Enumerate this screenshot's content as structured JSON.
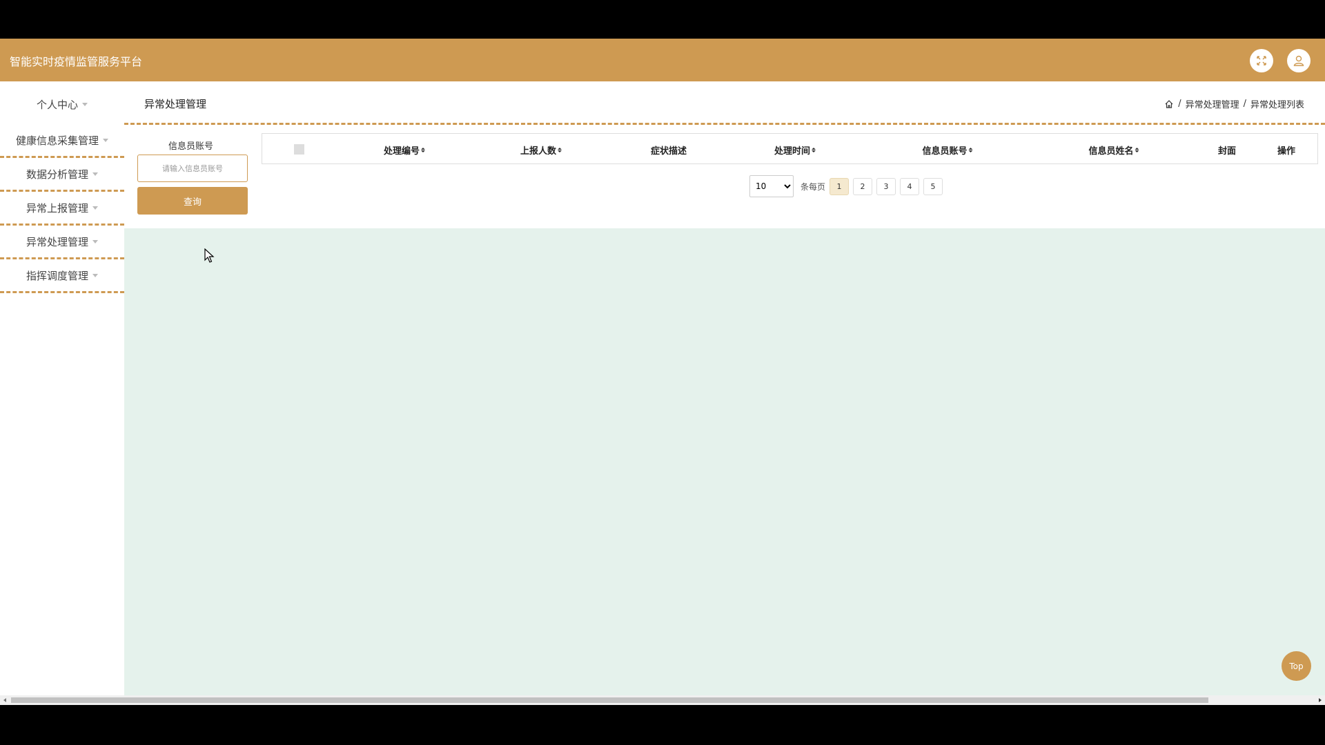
{
  "header": {
    "app_title": "智能实时疫情监管服务平台",
    "fullscreen_icon": "expand-icon",
    "user_icon": "user-icon"
  },
  "sidebar": {
    "items": [
      {
        "label": "个人中心"
      },
      {
        "label": "健康信息采集管理"
      },
      {
        "label": "数据分析管理"
      },
      {
        "label": "异常上报管理"
      },
      {
        "label": "异常处理管理"
      },
      {
        "label": "指挥调度管理"
      }
    ]
  },
  "main": {
    "page_title": "异常处理管理",
    "breadcrumb": [
      "异常处理管理",
      "异常处理列表"
    ],
    "breadcrumb_separator": "/",
    "search": {
      "label": "信息员账号",
      "placeholder": "请输入信息员账号",
      "value": "",
      "button": "查询"
    },
    "table": {
      "columns": [
        "处理编号",
        "上报人数",
        "症状描述",
        "处理时间",
        "信息员账号",
        "信息员姓名",
        "封面",
        "操作"
      ],
      "rows": []
    },
    "pagination": {
      "page_size": "10",
      "page_size_options": [
        "10"
      ],
      "per_page_label": "条每页",
      "pages": [
        "1",
        "2",
        "3",
        "4",
        "5"
      ],
      "current_page": "1"
    }
  },
  "top_button": "Top",
  "colors": {
    "accent": "#CE9A52",
    "content_bg": "#E5F2EC"
  }
}
